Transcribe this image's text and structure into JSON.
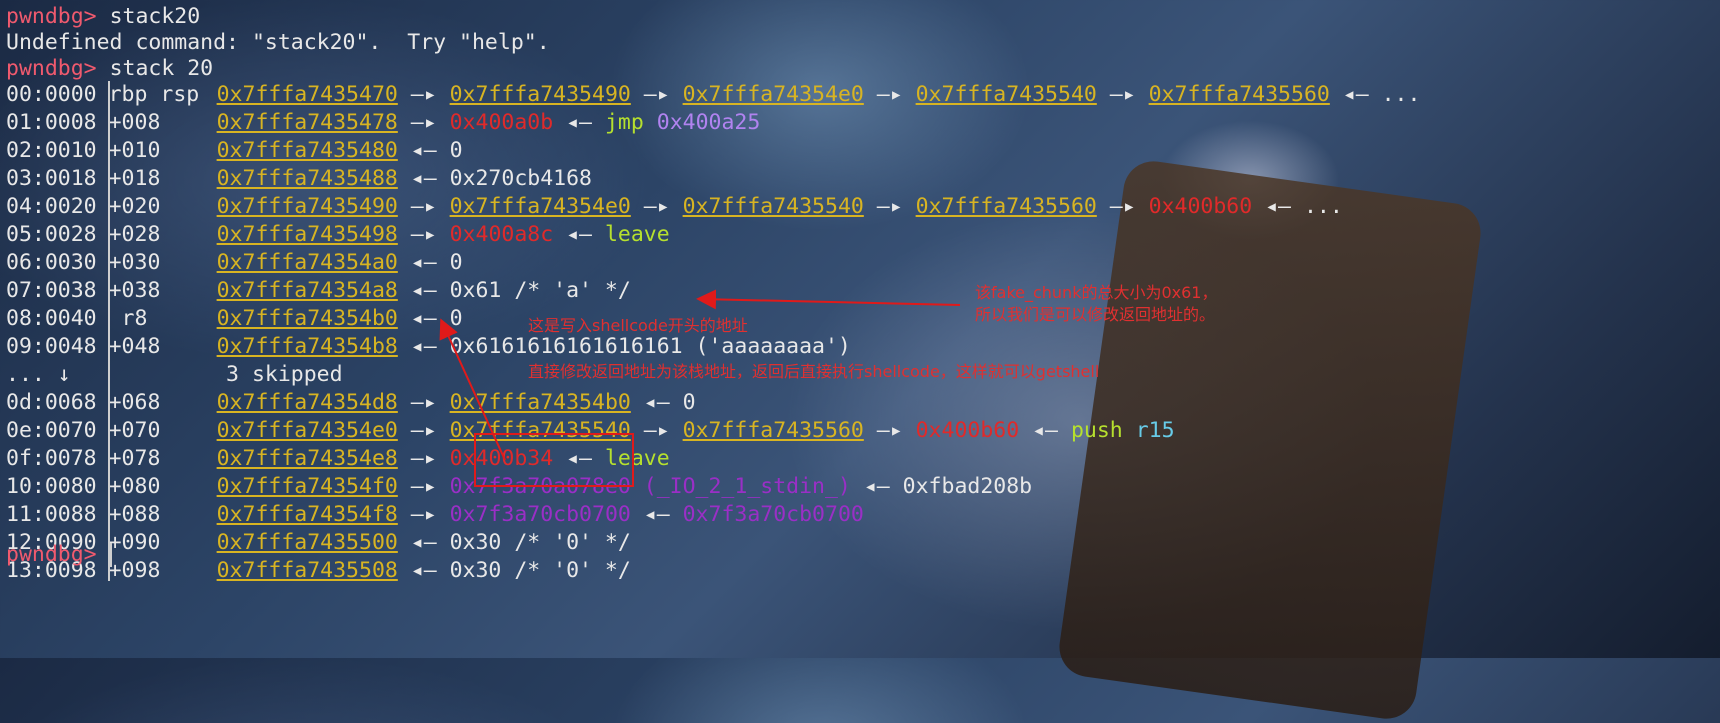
{
  "background": {
    "description": "anime wallpaper",
    "tones": [
      "#1b2a44",
      "#3b5478",
      "#3a2a1e"
    ]
  },
  "colors": {
    "prompt": "#f05a6e",
    "address": "#d8b422",
    "code": "#e02a2a",
    "instr": "#b6e02e",
    "operand": "#b183f0",
    "libc": "#9a2fc6",
    "register": "#67cbe8"
  },
  "lines": [
    {
      "prompt": "pwndbg> ",
      "cmd": "stack20"
    },
    {
      "text": "Undefined command: \"stack20\".  Try \"help\"."
    },
    {
      "prompt": "pwndbg> ",
      "cmd": "stack 20"
    }
  ],
  "stack": [
    {
      "idx": "00:0000",
      "off": "rbp rsp",
      "addr": "0x7fffa7435470",
      "rest": [
        {
          "t": " —▸ "
        },
        {
          "t": "0x7fffa7435490",
          "c": "yel"
        },
        {
          "t": " —▸ "
        },
        {
          "t": "0x7fffa74354e0",
          "c": "yel"
        },
        {
          "t": " —▸ "
        },
        {
          "t": "0x7fffa7435540",
          "c": "yel"
        },
        {
          "t": " —▸ "
        },
        {
          "t": "0x7fffa7435560",
          "c": "yel"
        },
        {
          "t": " ◂— ..."
        }
      ]
    },
    {
      "idx": "01:0008",
      "off": "+008",
      "addr": "0x7fffa7435478",
      "rest": [
        {
          "t": " —▸ "
        },
        {
          "t": "0x400a0b",
          "c": "red"
        },
        {
          "t": " ◂— "
        },
        {
          "t": "jmp",
          "c": "grn"
        },
        {
          "t": " "
        },
        {
          "t": "0x400a25",
          "c": "pur"
        }
      ]
    },
    {
      "idx": "02:0010",
      "off": "+010",
      "addr": "0x7fffa7435480",
      "rest": [
        {
          "t": " ◂— 0"
        }
      ]
    },
    {
      "idx": "03:0018",
      "off": "+018",
      "addr": "0x7fffa7435488",
      "rest": [
        {
          "t": " ◂— 0x270cb4168"
        }
      ]
    },
    {
      "idx": "04:0020",
      "off": "+020",
      "addr": "0x7fffa7435490",
      "rest": [
        {
          "t": " —▸ "
        },
        {
          "t": "0x7fffa74354e0",
          "c": "yel"
        },
        {
          "t": " —▸ "
        },
        {
          "t": "0x7fffa7435540",
          "c": "yel"
        },
        {
          "t": " —▸ "
        },
        {
          "t": "0x7fffa7435560",
          "c": "yel"
        },
        {
          "t": " —▸ "
        },
        {
          "t": "0x400b60",
          "c": "red"
        },
        {
          "t": " ◂— ..."
        }
      ]
    },
    {
      "idx": "05:0028",
      "off": "+028",
      "addr": "0x7fffa7435498",
      "rest": [
        {
          "t": " —▸ "
        },
        {
          "t": "0x400a8c",
          "c": "red"
        },
        {
          "t": " ◂— "
        },
        {
          "t": "leave",
          "c": "grn"
        }
      ]
    },
    {
      "idx": "06:0030",
      "off": "+030",
      "addr": "0x7fffa74354a0",
      "rest": [
        {
          "t": " ◂— 0"
        }
      ]
    },
    {
      "idx": "07:0038",
      "off": "+038",
      "addr": "0x7fffa74354a8",
      "rest": [
        {
          "t": " ◂— 0x61 /* 'a' */"
        }
      ]
    },
    {
      "idx": "08:0040",
      "off": " r8",
      "addr": "0x7fffa74354b0",
      "rest": [
        {
          "t": " ◂— 0"
        }
      ]
    },
    {
      "idx": "09:0048",
      "off": "+048",
      "addr": "0x7fffa74354b8",
      "rest": [
        {
          "t": " ◂— 0x6161616161616161 ('aaaaaaaa')"
        }
      ]
    },
    {
      "skip": true,
      "text": "... ↓            3 skipped"
    },
    {
      "idx": "0d:0068",
      "off": "+068",
      "addr": "0x7fffa74354d8",
      "rest": [
        {
          "t": " —▸ "
        },
        {
          "t": "0x7fffa74354b0",
          "c": "yel"
        },
        {
          "t": " ◂— 0"
        }
      ]
    },
    {
      "idx": "0e:0070",
      "off": "+070",
      "addr": "0x7fffa74354e0",
      "rest": [
        {
          "t": " —▸ "
        },
        {
          "t": "0x7fffa7435540",
          "c": "yel"
        },
        {
          "t": " —▸ "
        },
        {
          "t": "0x7fffa7435560",
          "c": "yel"
        },
        {
          "t": " —▸ "
        },
        {
          "t": "0x400b60",
          "c": "red"
        },
        {
          "t": " ◂— "
        },
        {
          "t": "push",
          "c": "grn"
        },
        {
          "t": " "
        },
        {
          "t": "r15",
          "c": "cyn"
        }
      ]
    },
    {
      "idx": "0f:0078",
      "off": "+078",
      "addr": "0x7fffa74354e8",
      "rest": [
        {
          "t": " —▸ "
        },
        {
          "t": "0x400b34",
          "c": "red"
        },
        {
          "t": " ◂— "
        },
        {
          "t": "leave",
          "c": "grn"
        }
      ]
    },
    {
      "idx": "10:0080",
      "off": "+080",
      "addr": "0x7fffa74354f0",
      "rest": [
        {
          "t": " —▸ "
        },
        {
          "t": "0x7f3a70a078e0 (_IO_2_1_stdin_)",
          "c": "mag"
        },
        {
          "t": " ◂— 0xfbad208b"
        }
      ]
    },
    {
      "idx": "11:0088",
      "off": "+088",
      "addr": "0x7fffa74354f8",
      "rest": [
        {
          "t": " —▸ "
        },
        {
          "t": "0x7f3a70cb0700",
          "c": "mag"
        },
        {
          "t": " ◂— "
        },
        {
          "t": "0x7f3a70cb0700",
          "c": "mag"
        }
      ]
    },
    {
      "idx": "12:0090",
      "off": "+090",
      "addr": "0x7fffa7435500",
      "rest": [
        {
          "t": " ◂— 0x30 /* '0' */"
        }
      ]
    },
    {
      "idx": "13:0098",
      "off": "+098",
      "addr": "0x7fffa7435508",
      "rest": [
        {
          "t": " ◂— 0x30 /* '0' */"
        }
      ]
    }
  ],
  "final_prompt": "pwndbg> ",
  "annotations": {
    "note1_line1": "该fake_chunk的总大小为0x61，",
    "note1_line2": "所以我们是可以修改返回地址的。",
    "note2": "这是写入shellcode开头的地址",
    "note3": "直接修改返回地址为该栈地址，返回后直接执行shellcode，这样就可以getshell"
  }
}
